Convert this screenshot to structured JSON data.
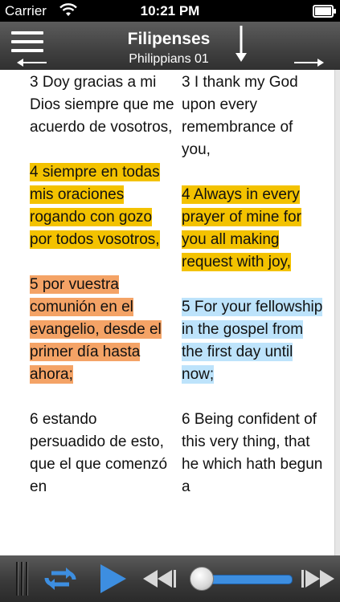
{
  "status_bar": {
    "carrier": "Carrier",
    "time": "10:21 PM"
  },
  "nav": {
    "title": "Filipenses",
    "subtitle": "Philippians 01"
  },
  "verses_es": [
    {
      "text": "3 Doy gracias a mi Dios siempre que me acuerdo de vosotros,",
      "highlight": "none"
    },
    {
      "text": "4 siempre en todas mis oraciones rogando con gozo por todos vosotros,",
      "highlight": "yellow"
    },
    {
      "text": "5 por vuestra comunión en el evangelio, desde el primer día hasta ahora;",
      "highlight": "orange"
    },
    {
      "text": "6 estando persuadido de esto, que el que comenzó en",
      "highlight": "none"
    }
  ],
  "verses_en": [
    {
      "text": "3 I thank my God upon every remembrance of you,",
      "highlight": "none"
    },
    {
      "text": "4 Always in every prayer of mine for you all making request with joy,",
      "highlight": "yellow"
    },
    {
      "text": "5 For your fellowship in the gospel from the first day until now;",
      "highlight": "blue"
    },
    {
      "text": "6 Being confident of this very thing, that he which hath begun a",
      "highlight": "none"
    }
  ],
  "highlight_colors": {
    "yellow": "#f3c200",
    "orange": "#f4a366",
    "blue": "#bde3fb"
  },
  "player": {
    "progress": 0.0,
    "icons": [
      "repeat-icon",
      "play-icon",
      "rewind-icon",
      "fast-forward-icon"
    ]
  }
}
